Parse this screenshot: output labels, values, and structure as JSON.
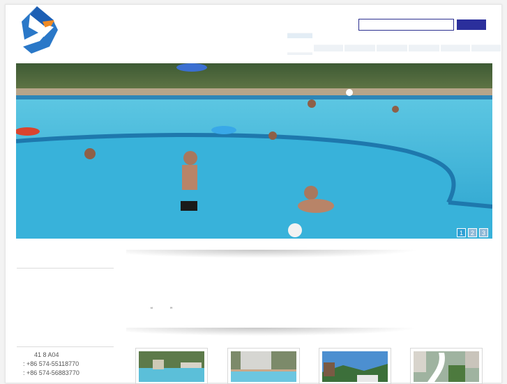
{
  "header": {
    "logo_name": "company-logo",
    "search": {
      "placeholder": "",
      "value": "",
      "button_label": ""
    }
  },
  "nav": {
    "items": [
      {
        "label": ""
      },
      {
        "label": ""
      },
      {
        "label": ""
      },
      {
        "label": ""
      },
      {
        "label": ""
      },
      {
        "label": ""
      },
      {
        "label": ""
      }
    ]
  },
  "slider": {
    "pages": [
      "1",
      "2",
      "3"
    ],
    "active_page": "1"
  },
  "intro": {
    "quote": "“          ”"
  },
  "contact": {
    "address": "41 8 A04",
    "tel": ": +86 574-55118770",
    "fax": ": +86 574-56883770"
  },
  "colors": {
    "brand_blue": "#2b2f9c",
    "pool_blue": "#3fb8d8",
    "logo_orange": "#f08a24"
  }
}
